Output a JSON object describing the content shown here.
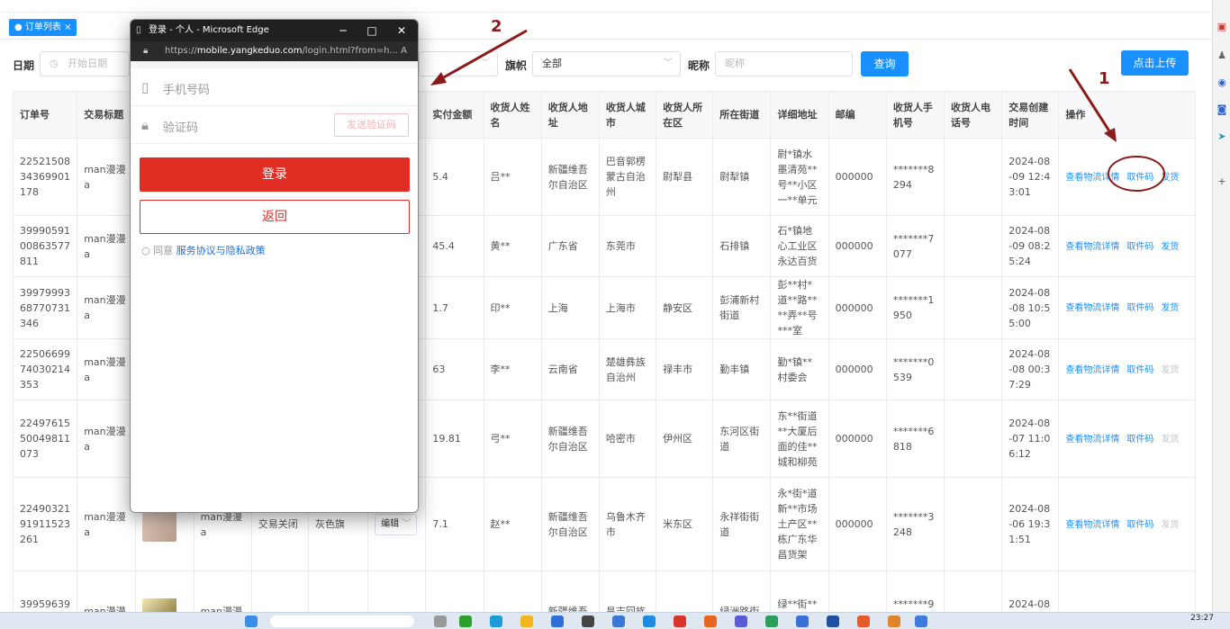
{
  "tab": {
    "label": "订单列表"
  },
  "filter": {
    "date_label": "日期",
    "date_placeholder": "开始日期",
    "select_value": "",
    "flag_label": "旗帜",
    "flag_value": "全部",
    "nick_label": "昵称",
    "nick_placeholder": "昵称",
    "query_label": "查询",
    "upload_label": "点击上传"
  },
  "table": {
    "headers": [
      "订单号",
      "交易标题",
      "",
      "",
      "",
      "",
      "",
      "实付金额",
      "收货人姓名",
      "收货人地址",
      "收货人城市",
      "收货人所在区",
      "所在街道",
      "详细地址",
      "邮编",
      "收货人手机号",
      "收货人电话号",
      "交易创建时间",
      "操作"
    ],
    "rows": [
      {
        "order": "2252150834369901178",
        "title": "man漫漫a",
        "amount": "5.4",
        "name": "吕**",
        "province": "新疆维吾尔自治区",
        "city": "巴音郭楞蒙古自治州",
        "district": "尉犁县",
        "street": "尉犁镇",
        "address": "尉*镇水墨清苑**号**小区一**单元",
        "zip": "000000",
        "phone": "*******8294",
        "time": "2024-08-09 12:43:01"
      },
      {
        "order": "3999059100863577811",
        "title": "man漫漫a",
        "amount": "45.4",
        "name": "黄**",
        "province": "广东省",
        "city": "东莞市",
        "district": "",
        "street": "石排镇",
        "address": "石*镇地心工业区永达百货",
        "zip": "000000",
        "phone": "*******7077",
        "time": "2024-08-09 08:25:24"
      },
      {
        "order": "3997999368770731346",
        "title": "man漫漫a",
        "amount": "1.7",
        "name": "印**",
        "province": "上海",
        "city": "上海市",
        "district": "静安区",
        "street": "彭浦新村街道",
        "address": "彭**村*道**路****弄**号***室",
        "zip": "000000",
        "phone": "*******1950",
        "time": "2024-08-08 10:55:00"
      },
      {
        "order": "2250669974030214353",
        "title": "man漫漫a",
        "amount": "63",
        "name": "李**",
        "province": "云南省",
        "city": "楚雄彝族自治州",
        "district": "禄丰市",
        "street": "勤丰镇",
        "address": "勤*镇**村委会",
        "zip": "000000",
        "phone": "*******0539",
        "time": "2024-08-08 00:37:29"
      },
      {
        "order": "2249761550049811073",
        "title": "man漫漫a",
        "amount": "19.81",
        "name": "弓**",
        "province": "新疆维吾尔自治区",
        "city": "哈密市",
        "district": "伊州区",
        "street": "东河区街道",
        "address": "东**街道**大厦后面的佳**城和柳苑",
        "zip": "000000",
        "phone": "*******6818",
        "time": "2024-08-07 11:06:12"
      },
      {
        "order": "2249032191911523261",
        "title": "man漫漫a",
        "title2": "man漫漫a",
        "status": "交易关闭",
        "flag": "灰色旗",
        "edit": "编辑",
        "amount": "7.1",
        "name": "赵**",
        "province": "新疆维吾尔自治区",
        "city": "乌鲁木齐市",
        "district": "米东区",
        "street": "永祥街街道",
        "address": "永*街*道新**市场土产区**栋广东华昌货架",
        "zip": "000000",
        "phone": "*******3248",
        "time": "2024-08-06 19:31:51"
      },
      {
        "order": "399596396",
        "title": "man漫漫",
        "title2": "man漫漫",
        "amount": "",
        "name": "",
        "province": "新疆维吾",
        "city": "昌吉回族",
        "district": "",
        "street": "绿洲路街",
        "address": "绿**街**路管理**",
        "zip": "",
        "phone": "*******918",
        "time": "2024-08-"
      }
    ],
    "actions": {
      "logistics": "查看物流详情",
      "pickup": "取件码",
      "ship": "发货"
    }
  },
  "popup": {
    "title": "登录 - 个人 - Microsoft Edge",
    "url_prefix": "https://",
    "url_domain": "mobile.yangkeduo.com",
    "url_rest": "/login.html?from=h...",
    "phone_placeholder": "手机号码",
    "code_placeholder": "验证码",
    "send_code": "发送验证码",
    "login": "登录",
    "back": "返回",
    "agree_text": "同意",
    "agree_link": "服务协议与隐私政策"
  },
  "annotations": {
    "num1": "1",
    "num2": "2"
  },
  "taskbar": {
    "time": "23:27"
  },
  "colors": {
    "accent": "#1890ff",
    "pdd_red": "#e02e24",
    "annotation": "#8b1a1a"
  }
}
